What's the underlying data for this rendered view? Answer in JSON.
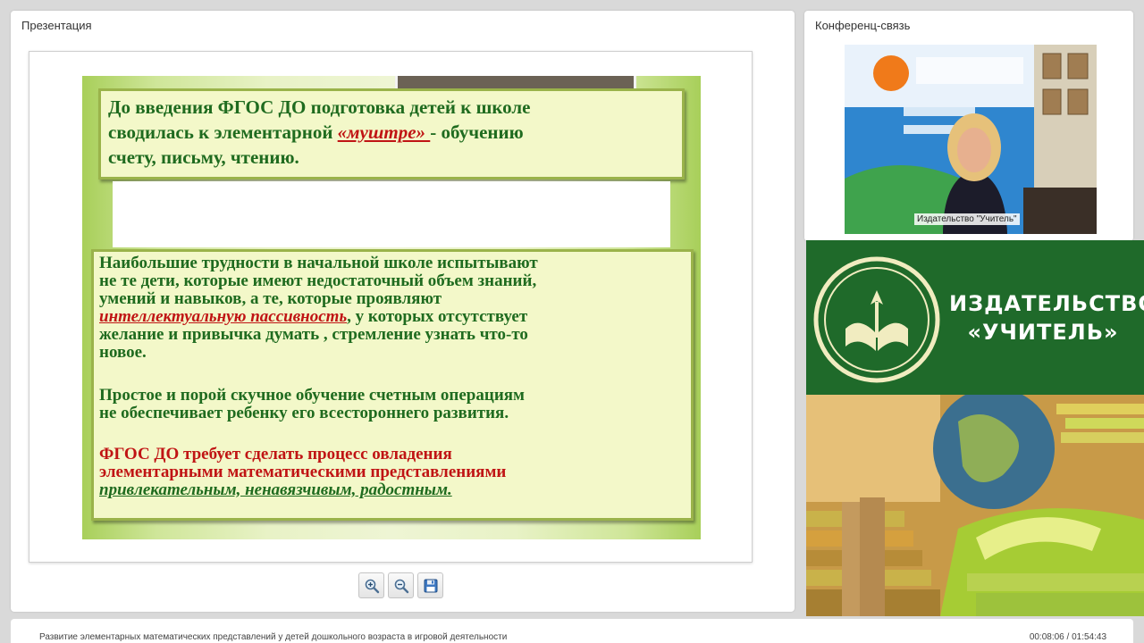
{
  "presentation": {
    "title": "Презентация",
    "slide": {
      "box1": {
        "line1": "До введения ФГОС ДО  подготовка детей к школе",
        "line2_pre": "сводилась к элементарной ",
        "line2_em": "«муштре» ",
        "line2_post": "-  обучению",
        "line3": "счету, письму, чтению."
      },
      "box2": {
        "p1_line1": "Наибольшие трудности в начальной школе испытывают",
        "p1_line2": "не те дети, которые имеют недостаточный объем знаний,",
        "p1_line3": "умений и навыков, а те, которые проявляют",
        "p1_em": "интеллектуальную пассивность",
        "p1_line4_post": ", у которых отсутствует",
        "p1_line5": "желание и привычка думать , стремление узнать что-то",
        "p1_line6": "новое.",
        "p2_line1": "Простое и порой скучное обучение счетным операциям",
        "p2_line2": "не обеспечивает ребенку его всестороннего развития.",
        "p3_line1": "ФГОС ДО  требует сделать процесс овладения",
        "p3_line2": "элементарными математическими представлениями",
        "p3_em": "привлекательным, ненавязчивым, радостным."
      }
    }
  },
  "toolbar": {
    "zoom_in_icon": "zoom-in-icon",
    "zoom_out_icon": "zoom-out-icon",
    "save_icon": "floppy-disk-icon"
  },
  "conference": {
    "title": "Конференц-связь",
    "participant_label": "Издательство \"Учитель\""
  },
  "banner": {
    "name_line1": "ИЗДАТЕЛЬСТВО",
    "name_line2": "«УЧИТЕЛЬ»"
  },
  "footer": {
    "title": "Развитие элементарных математических представлений у детей дошкольного возраста в игровой деятельности",
    "time": "00:08:06 / 01:54:43"
  },
  "colors": {
    "slide_green_text": "#1f6b1f",
    "slide_red_text": "#c01414",
    "banner_green": "#1f6a2a"
  }
}
